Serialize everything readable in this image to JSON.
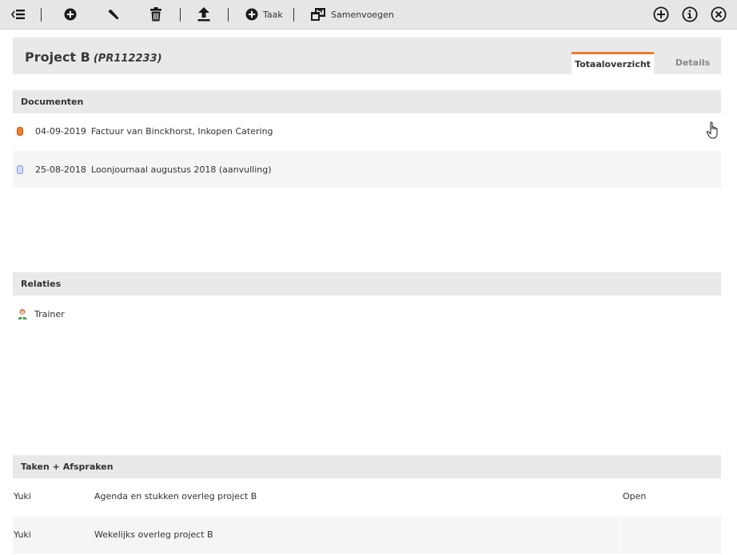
{
  "toolbar": {
    "items": [
      {
        "icon": "collapse-menu-icon"
      },
      {
        "icon": "add-icon"
      },
      {
        "icon": "edit-icon"
      },
      {
        "icon": "delete-icon"
      },
      {
        "icon": "upload-icon"
      },
      {
        "icon": "add-task-icon",
        "label": "Taak"
      },
      {
        "icon": "merge-icon",
        "label": "Samenvoegen"
      }
    ],
    "right_icons": [
      "new-icon",
      "info-icon",
      "close-icon"
    ]
  },
  "header": {
    "title": "Project B",
    "code": "(PR112233)",
    "tabs": [
      {
        "label": "Totaaloverzicht",
        "active": true
      },
      {
        "label": "Details",
        "active": false
      }
    ]
  },
  "documents": {
    "heading": "Documenten",
    "items": [
      {
        "date": "04-09-2019",
        "title": "Factuur van Binckhorst, Inkopen Catering",
        "icon_color": "#f07a2e"
      },
      {
        "date": "25-08-2018",
        "title": "Loonjournaal augustus 2018 (aanvulling)",
        "icon_color": "#a9b8e6"
      }
    ]
  },
  "relations": {
    "heading": "Relaties",
    "items": [
      {
        "name": "Trainer"
      }
    ]
  },
  "tasks": {
    "heading": "Taken + Afspraken",
    "items": [
      {
        "owner": "Yuki",
        "subject": "Agenda en stukken overleg project B",
        "status": "Open"
      },
      {
        "owner": "Yuki",
        "subject": "Wekelijks overleg project B",
        "status": ""
      }
    ]
  },
  "colors": {
    "accent": "#f07a2e",
    "toolbar_bg": "#e6e6e6",
    "section_bg": "#e9e9e9"
  }
}
